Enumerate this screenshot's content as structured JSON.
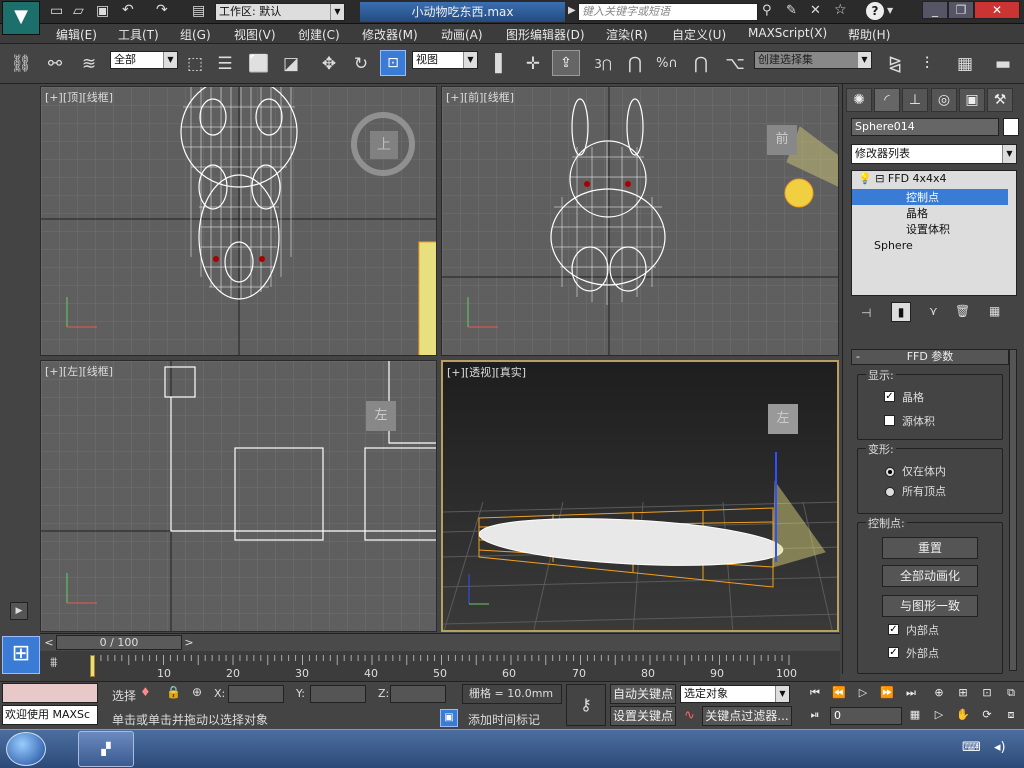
{
  "title_bar": {
    "workspace_label": "工作区: 默认",
    "file_title": "小动物吃东西.max",
    "search_placeholder": "键入关键字或短语"
  },
  "menus": [
    "编辑(E)",
    "工具(T)",
    "组(G)",
    "视图(V)",
    "创建(C)",
    "修改器(M)",
    "动画(A)",
    "图形编辑器(D)",
    "渲染(R)",
    "自定义(U)",
    "MAXScript(X)",
    "帮助(H)"
  ],
  "toolbar": {
    "selection_filter": "全部",
    "reference_coord": "视图",
    "angle_snap": "3",
    "percent_snap": "%",
    "named_selection": "创建选择集"
  },
  "viewports": {
    "top": {
      "bracket": "[+]",
      "view": "[顶]",
      "mode": "[线框]",
      "cube_label": "上"
    },
    "front": {
      "bracket": "[+]",
      "view": "[前]",
      "mode": "[线框]",
      "cube_label": "前"
    },
    "left": {
      "bracket": "[+]",
      "view": "[左]",
      "mode": "[线框]",
      "cube_label": "左"
    },
    "persp": {
      "bracket": "[+]",
      "view": "[透视]",
      "mode": "[真实]",
      "cube_label": "左"
    }
  },
  "command_panel": {
    "object_name": "Sphere014",
    "modifier_list": "修改器列表",
    "stack": {
      "modifier": "FFD 4x4x4",
      "sub_control_points": "控制点",
      "sub_lattice": "晶格",
      "sub_set_volume": "设置体积",
      "base_object": "Sphere"
    },
    "rollout_title": "FFD 参数",
    "rollout_collapse": "-",
    "display": {
      "title": "显示:",
      "lattice": "晶格",
      "source_volume": "源体积"
    },
    "deform": {
      "title": "变形:",
      "only_in_volume": "仅在体内",
      "all_vertices": "所有顶点"
    },
    "control_points": {
      "title": "控制点:",
      "reset": "重置",
      "animate_all": "全部动画化",
      "conform_to_shape": "与图形一致",
      "inside_points": "内部点",
      "outside_points": "外部点"
    }
  },
  "time_slider": {
    "frame": "0 / 100",
    "prev": "<",
    "next": ">"
  },
  "track_ticks": [
    "10",
    "20",
    "30",
    "40",
    "50",
    "60",
    "70",
    "80",
    "90",
    "100"
  ],
  "status": {
    "welcome": "欢迎使用 MAXSc",
    "selected_label": "选择",
    "prompt": "单击或单击并拖动以选择对象",
    "x_label": "X:",
    "y_label": "Y:",
    "z_label": "Z:",
    "grid": "栅格 = 10.0mm",
    "add_time_tag": "添加时间标记",
    "auto_key": "自动关键点",
    "set_key": "设置关键点",
    "key_filter_target": "选定对象",
    "key_filters": "关键点过滤器...",
    "current_frame": "0"
  },
  "colors": {
    "accent_selected": "#3a7bd5",
    "ffd_orange": "#f0a020",
    "light_yellow": "#e8e080"
  }
}
